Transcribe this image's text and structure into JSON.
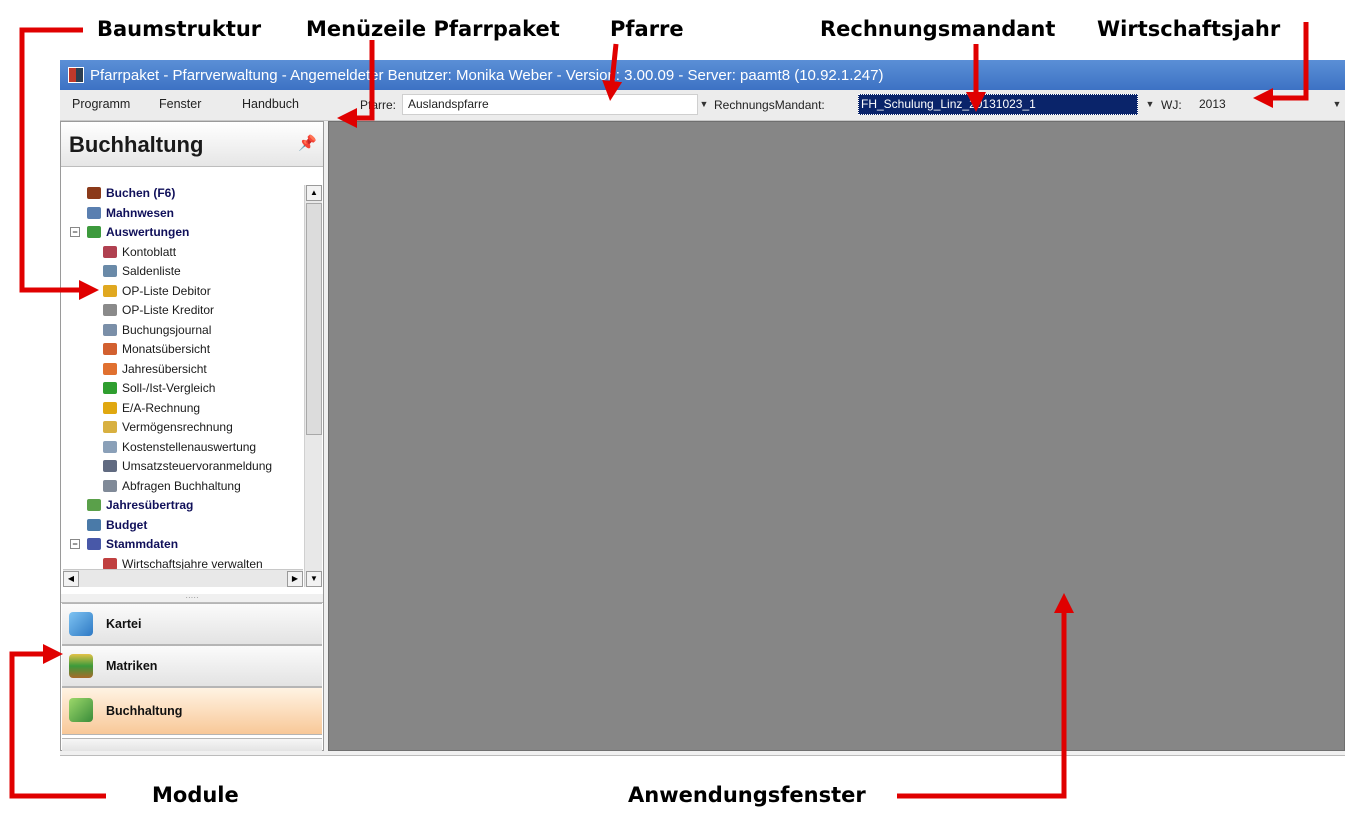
{
  "annotations": {
    "baumstruktur": "Baumstruktur",
    "menuezeile": "Menüzeile Pfarrpaket",
    "pfarre": "Pfarre",
    "rechnungsmandant": "Rechnungsmandant",
    "wirtschaftsjahr": "Wirtschaftsjahr",
    "module": "Module",
    "anwendungsfenster": "Anwendungsfenster",
    "arrow_color": "#e00000"
  },
  "window": {
    "title": "Pfarrpaket - Pfarrverwaltung - Angemeldeter Benutzer: Monika Weber - Version: 3.00.09 - Server: paamt8 (10.92.1.247)"
  },
  "menubar": {
    "items": [
      "Programm",
      "Fenster",
      "Handbuch"
    ],
    "pfarre_label": "Pfarre:",
    "pfarre_value": "Auslandspfarre",
    "mandant_label": "RechnungsMandant:",
    "mandant_value": "FH_Schulung_Linz_20131023_1",
    "wj_label": "WJ:",
    "wj_value": "2013"
  },
  "panel": {
    "title": "Buchhaltung",
    "tree": [
      {
        "label": "Buchen (F6)",
        "bold": true,
        "icon": "book-icon"
      },
      {
        "label": "Mahnwesen",
        "bold": true,
        "icon": "eye-icon"
      },
      {
        "label": "Auswertungen",
        "bold": true,
        "icon": "chart-icon"
      },
      {
        "label": "Kontoblatt",
        "bold": false,
        "icon": "pen-icon"
      },
      {
        "label": "Saldenliste",
        "bold": false,
        "icon": "scale-icon"
      },
      {
        "label": "OP-Liste Debitor",
        "bold": false,
        "icon": "folder-icon"
      },
      {
        "label": "OP-Liste Kreditor",
        "bold": false,
        "icon": "folder-gray-icon"
      },
      {
        "label": "Buchungsjournal",
        "bold": false,
        "icon": "journal-icon"
      },
      {
        "label": "Monatsübersicht",
        "bold": false,
        "icon": "calendar-icon"
      },
      {
        "label": "Jahresübersicht",
        "bold": false,
        "icon": "calendar-red-icon"
      },
      {
        "label": "Soll-/Ist-Vergleich",
        "bold": false,
        "icon": "check-icon"
      },
      {
        "label": "E/A-Rechnung",
        "bold": false,
        "icon": "coin-icon"
      },
      {
        "label": "Vermögensrechnung",
        "bold": false,
        "icon": "bag-icon"
      },
      {
        "label": "Kostenstellenauswertung",
        "bold": false,
        "icon": "list-icon"
      },
      {
        "label": "Umsatzsteuervoranmeldung",
        "bold": false,
        "icon": "percent-icon"
      },
      {
        "label": "Abfragen Buchhaltung",
        "bold": false,
        "icon": "binoculars-icon"
      },
      {
        "label": "Jahresübertrag",
        "bold": true,
        "icon": "transfer-icon"
      },
      {
        "label": "Budget",
        "bold": true,
        "icon": "budget-icon"
      },
      {
        "label": "Stammdaten",
        "bold": true,
        "icon": "database-icon"
      },
      {
        "label": "Wirtschaftsjahre verwalten",
        "bold": false,
        "icon": "calendar-day-icon"
      }
    ],
    "modules": [
      {
        "label": "Kartei",
        "icon": "kartei-icon",
        "active": false
      },
      {
        "label": "Matriken",
        "icon": "matriken-icon",
        "active": false
      },
      {
        "label": "Buchhaltung",
        "icon": "buchhaltung-icon",
        "active": true
      }
    ]
  }
}
